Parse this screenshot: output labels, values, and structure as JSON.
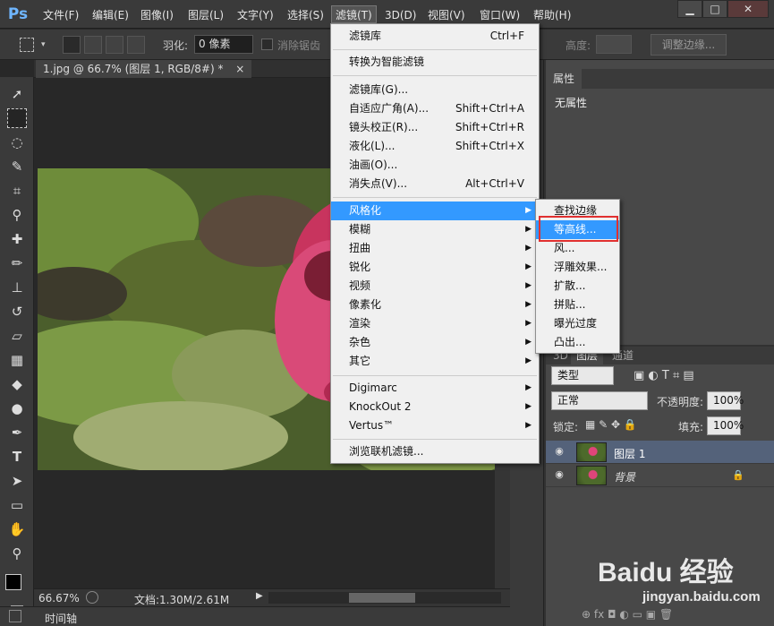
{
  "app_logo": "Ps",
  "menubar": {
    "items": [
      "文件(F)",
      "编辑(E)",
      "图像(I)",
      "图层(L)",
      "文字(Y)",
      "选择(S)",
      "滤镜(T)",
      "3D(D)",
      "视图(V)",
      "窗口(W)",
      "帮助(H)"
    ],
    "active": "滤镜(T)"
  },
  "window_controls": {
    "minimize": "▁",
    "restore": "□",
    "close": "✕"
  },
  "options": {
    "feather_label": "羽化:",
    "feather_value": "0 像素",
    "antialias_label": "消除锯齿",
    "height_label": "高度:",
    "refine_edge": "调整边缘..."
  },
  "document_tab": {
    "title": "1.jpg @ 66.7% (图层 1, RGB/8#) *",
    "close": "×"
  },
  "filter_menu": {
    "items": [
      {
        "label": "滤镜库",
        "shortcut": "Ctrl+F"
      },
      {
        "label": "转换为智能滤镜"
      },
      {
        "label": "滤镜库(G)..."
      },
      {
        "label": "自适应广角(A)...",
        "shortcut": "Shift+Ctrl+A"
      },
      {
        "label": "镜头校正(R)...",
        "shortcut": "Shift+Ctrl+R"
      },
      {
        "label": "液化(L)...",
        "shortcut": "Shift+Ctrl+X"
      },
      {
        "label": "油画(O)..."
      },
      {
        "label": "消失点(V)...",
        "shortcut": "Alt+Ctrl+V"
      },
      {
        "label": "风格化",
        "submenu": true,
        "highlighted": true
      },
      {
        "label": "模糊",
        "submenu": true
      },
      {
        "label": "扭曲",
        "submenu": true
      },
      {
        "label": "锐化",
        "submenu": true
      },
      {
        "label": "视频",
        "submenu": true
      },
      {
        "label": "像素化",
        "submenu": true
      },
      {
        "label": "渲染",
        "submenu": true
      },
      {
        "label": "杂色",
        "submenu": true
      },
      {
        "label": "其它",
        "submenu": true
      },
      {
        "label": "Digimarc",
        "submenu": true
      },
      {
        "label": "KnockOut 2",
        "submenu": true
      },
      {
        "label": "Vertus™",
        "submenu": true
      },
      {
        "label": "浏览联机滤镜..."
      }
    ]
  },
  "stylize_submenu": {
    "items": [
      {
        "label": "查找边缘"
      },
      {
        "label": "等高线...",
        "highlighted": true
      },
      {
        "label": "风..."
      },
      {
        "label": "浮雕效果..."
      },
      {
        "label": "扩散..."
      },
      {
        "label": "拼贴..."
      },
      {
        "label": "曝光过度"
      },
      {
        "label": "凸出..."
      }
    ]
  },
  "properties_panel": {
    "tab": "属性",
    "content": "无属性"
  },
  "layers_panel": {
    "tabs": [
      "3D",
      "图层",
      "通道"
    ],
    "active_tab": "图层",
    "filter_kind": "类型",
    "blend_mode": "正常",
    "opacity_label": "不透明度:",
    "opacity_value": "100%",
    "lock_label": "锁定:",
    "fill_label": "填充:",
    "fill_value": "100%",
    "layers": [
      {
        "name": "图层 1",
        "selected": true
      },
      {
        "name": "背景",
        "locked": true
      }
    ]
  },
  "status": {
    "zoom": "66.67%",
    "doc_size": "文档:1.30M/2.61M"
  },
  "timeline_label": "时间轴",
  "watermark": {
    "main": "Baidu 经验",
    "sub": "jingyan.baidu.com"
  },
  "colors": {
    "menu_highlight": "#3399ff",
    "callout_border": "#e03030",
    "panel_bg": "#484848",
    "app_bg": "#282828"
  }
}
